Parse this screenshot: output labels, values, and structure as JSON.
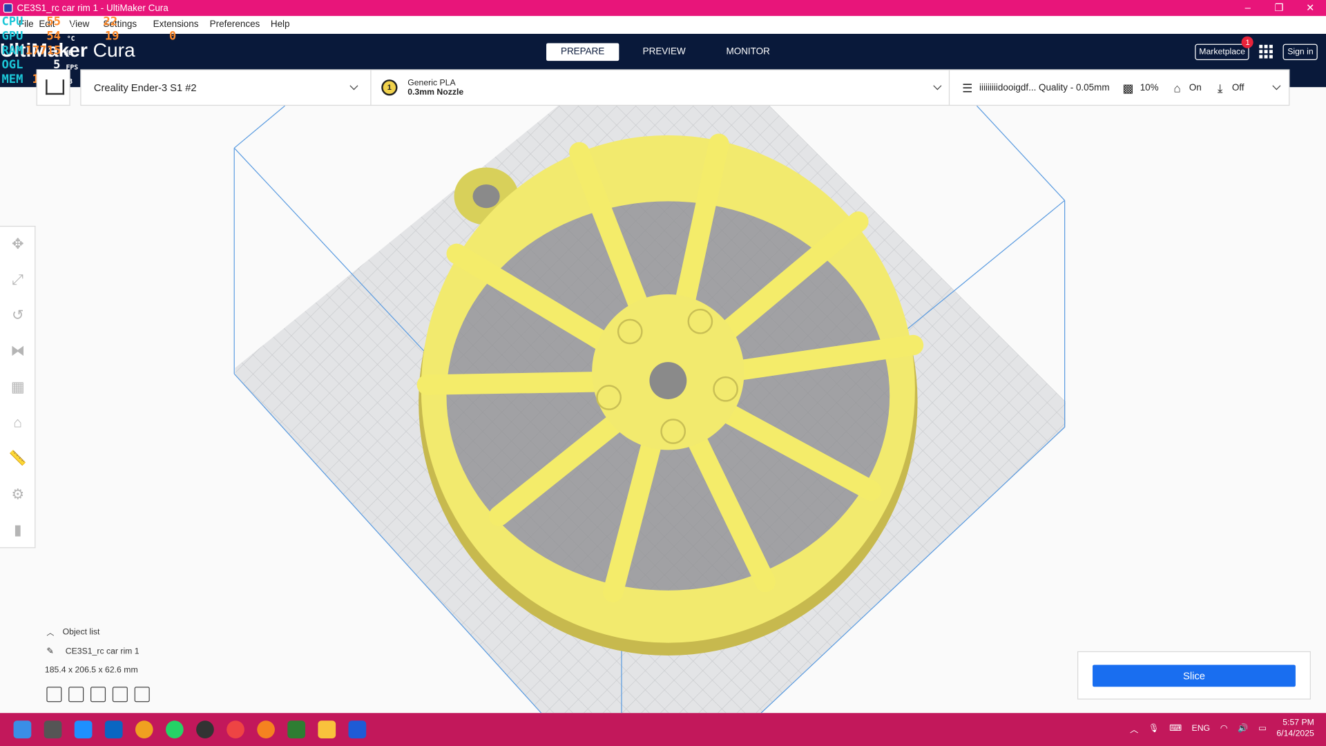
{
  "window": {
    "title": "CE3S1_rc car rim 1 - UltiMaker Cura",
    "controls": [
      "–",
      "❐",
      "✕"
    ]
  },
  "menu": {
    "items": [
      "File",
      "Edit",
      "View",
      "Settings",
      "Extensions",
      "Preferences",
      "Help"
    ]
  },
  "overlay": {
    "labels": [
      "CPU",
      "GPU",
      "RAM",
      "OGL",
      "MEM"
    ],
    "values": [
      "55",
      "54",
      "17715",
      "5",
      "1597"
    ],
    "units": [
      "°C",
      "°C",
      "MB",
      "FPS",
      "MB"
    ],
    "values2": [
      "22",
      "19",
      "",
      "",
      ""
    ],
    "extra": "0"
  },
  "header": {
    "logo_bold": "UltiMaker",
    "logo_thin": "Cura",
    "tabs": [
      "PREPARE",
      "PREVIEW",
      "MONITOR"
    ],
    "active_tab": "PREPARE",
    "marketplace_label": "Marketplace",
    "marketplace_badge": "1",
    "signin_label": "Sign in"
  },
  "machine_bar": {
    "printer_name": "Creality Ender-3 S1 #2",
    "extruder_number": "1",
    "material": "Generic PLA",
    "nozzle": "0.3mm Nozzle",
    "profile": "iiiiiiiiidooigdf... Quality - 0.05mm",
    "infill": "10%",
    "support": "On",
    "adhesion": "Off"
  },
  "toolbar": {
    "tools": [
      "move-tool",
      "scale-tool",
      "rotate-tool",
      "mirror-tool",
      "per-model-settings-tool",
      "support-blocker-tool",
      "measure-tool",
      "paint-tool",
      "cylinder-tool"
    ],
    "active": "measure-tool"
  },
  "object_panel": {
    "header": "Object list",
    "object_name": "CE3S1_rc car rim 1",
    "dimensions": "185.4 x 206.5 x 62.6 mm"
  },
  "slice_panel": {
    "slice_label": "Slice"
  },
  "taskbar": {
    "language": "ENG",
    "time": "5:57 PM",
    "date": "6/14/2025"
  },
  "colors": {
    "titlebar": "#e8157a",
    "header": "#09193a",
    "accent_button": "#196ef0",
    "model": "#f4ec6a",
    "taskbar": "#c2185b"
  }
}
